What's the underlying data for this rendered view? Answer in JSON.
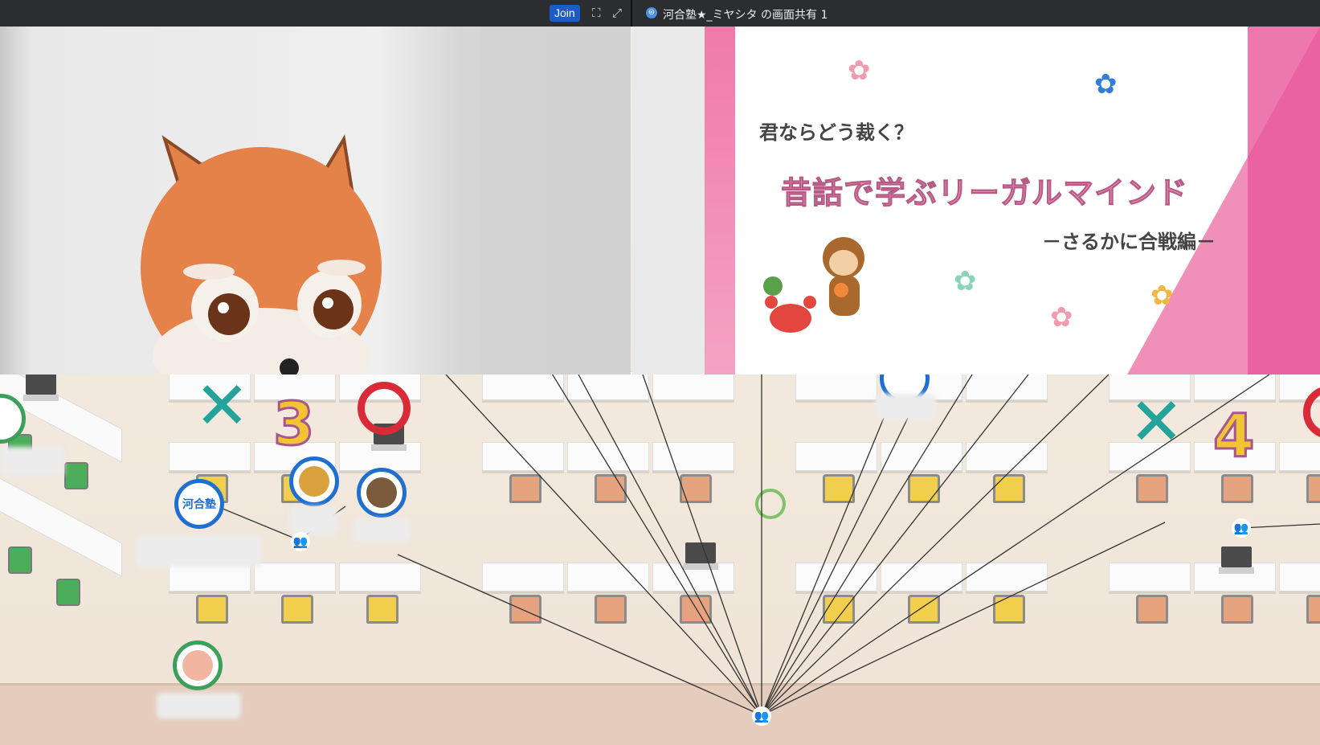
{
  "meeting": {
    "join_label": "Join",
    "screen_share_title": "河合塾★_ミヤシタ の画面共有 1"
  },
  "slide": {
    "question": "君ならどう裁く？",
    "title": "昔話で学ぶリーガルマインド",
    "subtitle": "－さるかに合戦編－"
  },
  "room": {
    "markers": {
      "x_symbol": "✕",
      "o_symbol": "○",
      "group3": "3",
      "group4": "4"
    },
    "avatars": [
      {
        "label": "河合塾"
      }
    ]
  },
  "colors": {
    "accent": "#1e5bc6",
    "pink": "#ec8fb1",
    "x_marker": "#23a39a",
    "o_marker": "#d92b37"
  }
}
